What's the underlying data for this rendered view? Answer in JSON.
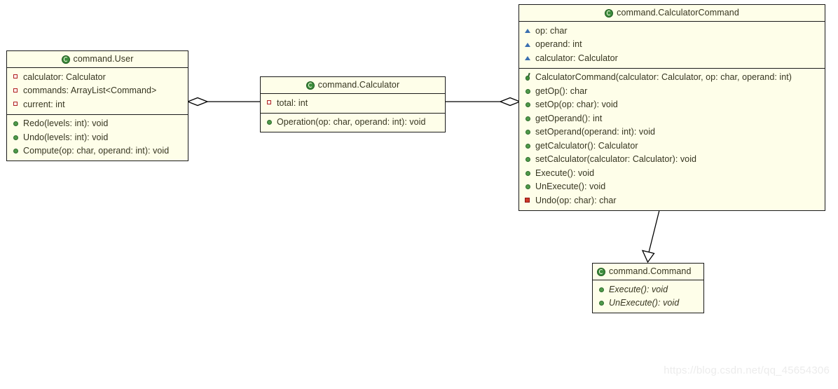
{
  "diagram": {
    "type": "uml-class-diagram",
    "watermark": "https://blog.csdn.net/qq_45654306",
    "colors": {
      "box_fill": "#fefee9",
      "box_border": "#1a1a1a",
      "text": "#363520",
      "class_icon": "#3c8c3c",
      "public_member": "#4f9a4a",
      "private_member": "#b02222",
      "package_member": "#3a6fb0",
      "edge": "#000000",
      "watermark": "#ececec"
    },
    "classes": [
      {
        "id": "user",
        "title": "command.User",
        "title_icon": "class-icon",
        "title_align": "center",
        "attributes": [
          {
            "icon": "private-attribute-icon",
            "label": "calculator: Calculator"
          },
          {
            "icon": "private-attribute-icon",
            "label": "commands: ArrayList<Command>"
          },
          {
            "icon": "private-attribute-icon",
            "label": "current: int"
          }
        ],
        "methods": [
          {
            "icon": "public-method-icon",
            "label": "Redo(levels: int): void"
          },
          {
            "icon": "public-method-icon",
            "label": "Undo(levels: int): void"
          },
          {
            "icon": "public-method-icon",
            "label": "Compute(op: char, operand: int): void"
          }
        ]
      },
      {
        "id": "calculator",
        "title": "command.Calculator",
        "title_icon": "class-icon",
        "title_align": "center",
        "attributes": [
          {
            "icon": "private-attribute-icon",
            "label": "total: int"
          }
        ],
        "methods": [
          {
            "icon": "public-method-icon",
            "label": "Operation(op: char, operand: int): void"
          }
        ]
      },
      {
        "id": "calculatorcommand",
        "title": "command.CalculatorCommand",
        "title_icon": "class-icon",
        "title_align": "center",
        "attributes": [
          {
            "icon": "package-attribute-icon",
            "label": "op: char"
          },
          {
            "icon": "package-attribute-icon",
            "label": "operand: int"
          },
          {
            "icon": "package-attribute-icon",
            "label": "calculator: Calculator"
          }
        ],
        "methods": [
          {
            "icon": "constructor-icon",
            "label": "CalculatorCommand(calculator: Calculator, op: char, operand: int)"
          },
          {
            "icon": "public-method-icon",
            "label": "getOp(): char"
          },
          {
            "icon": "public-method-icon",
            "label": "setOp(op: char): void"
          },
          {
            "icon": "public-method-icon",
            "label": "getOperand(): int"
          },
          {
            "icon": "public-method-icon",
            "label": "setOperand(operand: int): void"
          },
          {
            "icon": "public-method-icon",
            "label": "getCalculator(): Calculator"
          },
          {
            "icon": "public-method-icon",
            "label": "setCalculator(calculator: Calculator): void"
          },
          {
            "icon": "public-method-icon",
            "label": "Execute(): void"
          },
          {
            "icon": "public-method-icon",
            "label": "UnExecute(): void"
          },
          {
            "icon": "private-method-icon",
            "label": "Undo(op: char): char"
          }
        ]
      },
      {
        "id": "command",
        "title": "command.Command",
        "title_icon": "class-icon",
        "title_align": "left",
        "attributes": [],
        "methods": [
          {
            "icon": "public-method-icon",
            "label": "Execute(): void",
            "italic": true
          },
          {
            "icon": "public-method-icon",
            "label": "UnExecute(): void",
            "italic": true
          }
        ]
      }
    ],
    "relations": [
      {
        "id": "user-calculator",
        "kind": "aggregation",
        "from": "calculator",
        "to": "user",
        "label": ""
      },
      {
        "id": "calculator-calculatorcommand",
        "kind": "aggregation",
        "from": "calculator",
        "to": "calculatorcommand",
        "label": ""
      },
      {
        "id": "calculatorcommand-command",
        "kind": "realization",
        "from": "calculatorcommand",
        "to": "command",
        "label": ""
      }
    ]
  }
}
